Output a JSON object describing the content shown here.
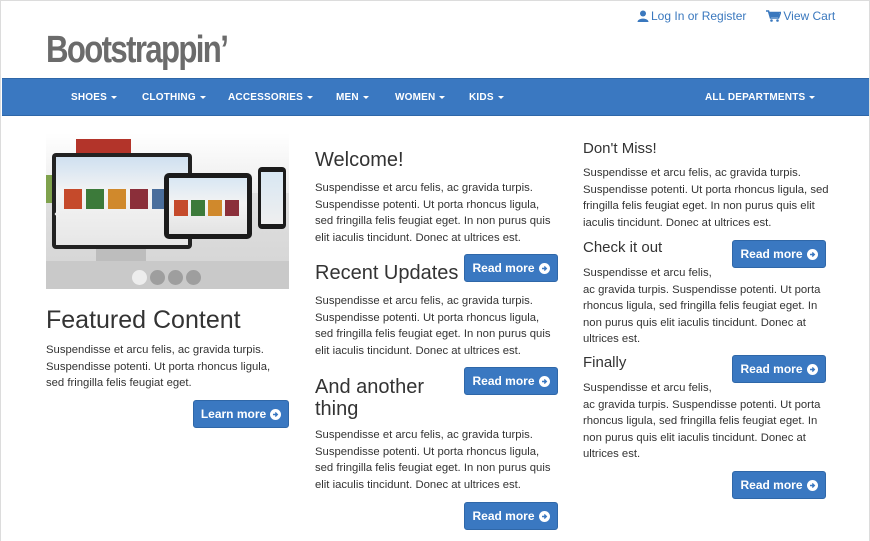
{
  "header": {
    "login_label": "Log In or Register",
    "cart_label": "View Cart",
    "logo_text": "Bootstrappin’"
  },
  "nav": {
    "items": [
      {
        "label": "SHOES"
      },
      {
        "label": "CLOTHING"
      },
      {
        "label": "ACCESSORIES"
      },
      {
        "label": "MEN"
      },
      {
        "label": "WOMEN"
      },
      {
        "label": "KIDS"
      }
    ],
    "all_departments": "ALL DEPARTMENTS"
  },
  "carousel": {
    "slide_count": 4,
    "active_slide": 1
  },
  "featured": {
    "title": "Featured Content",
    "body": "Suspendisse et arcu felis, ac gravida turpis. Suspendisse potenti. Ut porta rhoncus ligula, sed fringilla felis feugiat eget.",
    "button": "Learn more"
  },
  "middle": {
    "welcome_title": "Welcome!",
    "welcome_body": "Suspendisse et arcu felis, ac gravida turpis. Suspendisse potenti. Ut porta rhoncus ligula, sed fringilla felis feugiat eget. In non purus quis elit iaculis tincidunt. Donec at ultrices est.",
    "welcome_button": "Read more",
    "updates_title": "Recent Updates",
    "updates_body": "Suspendisse et arcu felis, ac gravida turpis. Suspendisse potenti. Ut porta rhoncus ligula, sed fringilla felis feugiat eget. In non purus quis elit iaculis tincidunt. Donec at ultrices est.",
    "updates_button": "Read more",
    "another_title_line1": "And another",
    "another_title_line2": "thing",
    "another_body": "Suspendisse et arcu felis, ac gravida turpis. Suspendisse potenti. Ut porta rhoncus ligula, sed fringilla felis feugiat eget. In non purus quis elit iaculis tincidunt. Donec at ultrices est.",
    "another_button": "Read more"
  },
  "right": {
    "dontmiss_title": "Don't Miss!",
    "dontmiss_body": "Suspendisse et arcu felis, ac gravida turpis. Suspendisse potenti. Ut porta rhoncus ligula, sed fringilla felis feugiat eget. In non purus quis elit iaculis tincidunt. Donec at ultrices est.",
    "dontmiss_button": "Read more",
    "checkit_title": "Check it out",
    "checkit_body_1": "Suspendisse et arcu felis,",
    "checkit_body_2": "ac gravida turpis. Suspendisse potenti. Ut porta rhoncus ligula, sed fringilla felis feugiat eget. In non purus quis elit iaculis tincidunt. Donec at ultrices est.",
    "checkit_button": "Read more",
    "finally_title": "Finally",
    "finally_body_1": "Suspendisse et arcu felis,",
    "finally_body_2": "ac gravida turpis. Suspendisse potenti. Ut porta rhoncus ligula, sed fringilla felis feugiat eget. In non purus quis elit iaculis tincidunt. Donec at ultrices est.",
    "finally_button": "Read more"
  },
  "icons": {
    "user": "user-icon",
    "cart": "cart-icon",
    "arrow": "arrow-circle-right-icon",
    "caret": "caret-down-icon",
    "chevron": "chevron-left-icon"
  },
  "colors": {
    "brand_blue": "#3a78c1",
    "link_blue": "#3a78be",
    "logo_gray": "#6b6b6b"
  }
}
